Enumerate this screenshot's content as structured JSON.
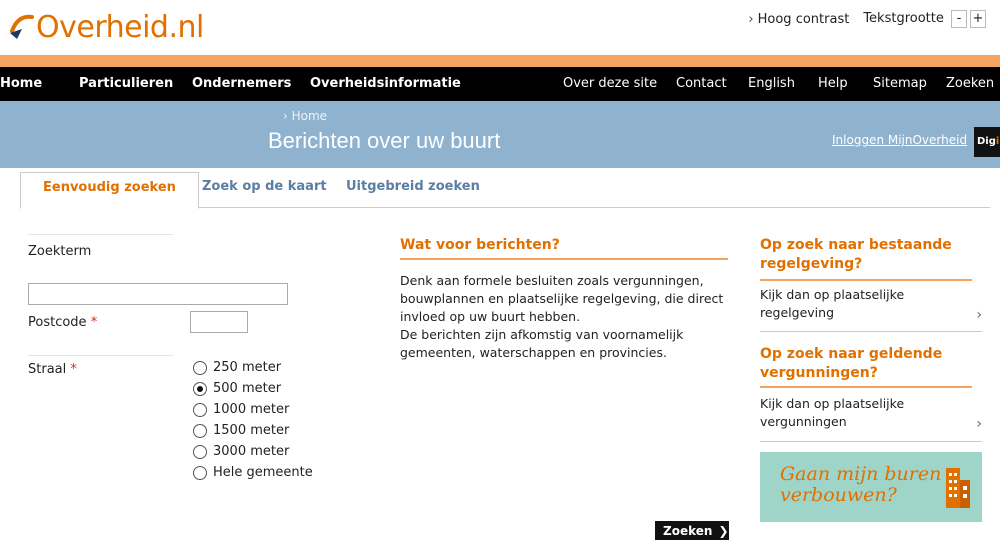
{
  "header": {
    "logo_text": "Overheid.nl",
    "high_contrast": "Hoog contrast",
    "text_size_label": "Tekstgrootte",
    "text_size_minus": "-",
    "text_size_plus": "+"
  },
  "nav": {
    "left": [
      "Home",
      "Particulieren",
      "Ondernemers",
      "Overheidsinformatie"
    ],
    "right": [
      "Over deze site",
      "Contact",
      "English",
      "Help",
      "Sitemap",
      "Zoeken"
    ]
  },
  "banner": {
    "breadcrumb": "Home",
    "title": "Berichten over uw buurt",
    "login_link": "Inloggen MijnOverheid",
    "digid": "DigiD"
  },
  "tabs": [
    {
      "label": "Eenvoudig zoeken",
      "active": true
    },
    {
      "label": "Zoek op de kaart",
      "active": false
    },
    {
      "label": "Uitgebreid zoeken",
      "active": false
    }
  ],
  "form": {
    "search_term_label": "Zoekterm",
    "search_term_value": "",
    "postcode_label": "Postcode",
    "postcode_value": "",
    "required_marker": "*",
    "radius_label": "Straal",
    "radius_options": [
      "250 meter",
      "500 meter",
      "1000 meter",
      "1500 meter",
      "3000 meter",
      "Hele gemeente"
    ],
    "radius_selected": "500 meter",
    "submit_label": "Zoeken"
  },
  "middle": {
    "title": "Wat voor berichten?",
    "paragraph1": "Denk aan formele besluiten zoals vergunningen, bouwplannen en plaatselijke regelgeving, die direct invloed op uw buurt hebben.",
    "paragraph2": "De berichten zijn afkomstig van voornamelijk gemeenten, waterschappen en provincies."
  },
  "right": {
    "box1_title": "Op zoek naar bestaande regelgeving?",
    "box1_link": "Kijk dan op plaatselijke regelgeving",
    "box2_title": "Op zoek naar geldende vergunningen?",
    "box2_link": "Kijk dan op plaatselijke vergunningen",
    "promo_line1": "Gaan mijn buren",
    "promo_line2": "verbouwen?"
  },
  "colors": {
    "brand_orange": "#e17000",
    "strip_orange": "#f4a460",
    "nav_black": "#000000",
    "banner_blue": "#8fb2cf",
    "tab_blue": "#5b7fa3",
    "promo_teal": "#9fd4c9"
  }
}
